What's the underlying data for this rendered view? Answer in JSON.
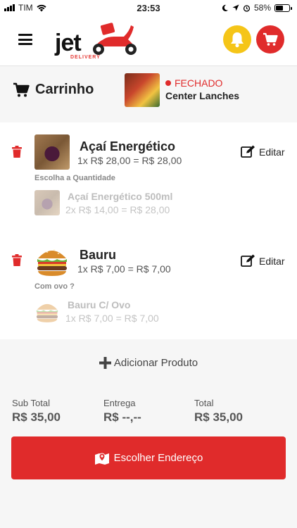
{
  "status_bar": {
    "carrier": "TIM",
    "time": "23:53",
    "battery": "58%",
    "battery_level": 0.58
  },
  "header": {
    "logo_text": "jet",
    "logo_sub": "DELIVERY",
    "colors": {
      "bell": "#f5c518",
      "cart": "#e02b2b"
    }
  },
  "cart": {
    "title": "Carrinho"
  },
  "store": {
    "status": "FECHADO",
    "name": "Center Lanches"
  },
  "items": [
    {
      "name": "Açaí Energético",
      "price_line": "1x R$ 28,00 = R$ 28,00",
      "edit_label": "Editar",
      "option_label": "Escolha a Quantidade",
      "option_name": "Açaí Energético 500ml",
      "option_price_line": "2x R$ 14,00 = R$ 28,00"
    },
    {
      "name": "Bauru",
      "price_line": "1x R$ 7,00 = R$ 7,00",
      "edit_label": "Editar",
      "option_label": "Com ovo ?",
      "option_name": "Bauru C/ Ovo",
      "option_price_line": "1x R$ 7,00 = R$ 7,00"
    }
  ],
  "actions": {
    "add_product": "Adicionar Produto",
    "choose_address": "Escolher Endereço"
  },
  "totals": {
    "subtotal_label": "Sub Total",
    "subtotal_value": "R$ 35,00",
    "delivery_label": "Entrega",
    "delivery_value": "R$ --,--",
    "total_label": "Total",
    "total_value": "R$ 35,00"
  },
  "icons": [
    "hamburger-menu-icon",
    "bell-icon",
    "cart-icon",
    "trash-icon",
    "edit-icon",
    "plus-icon",
    "map-pin-icon"
  ]
}
